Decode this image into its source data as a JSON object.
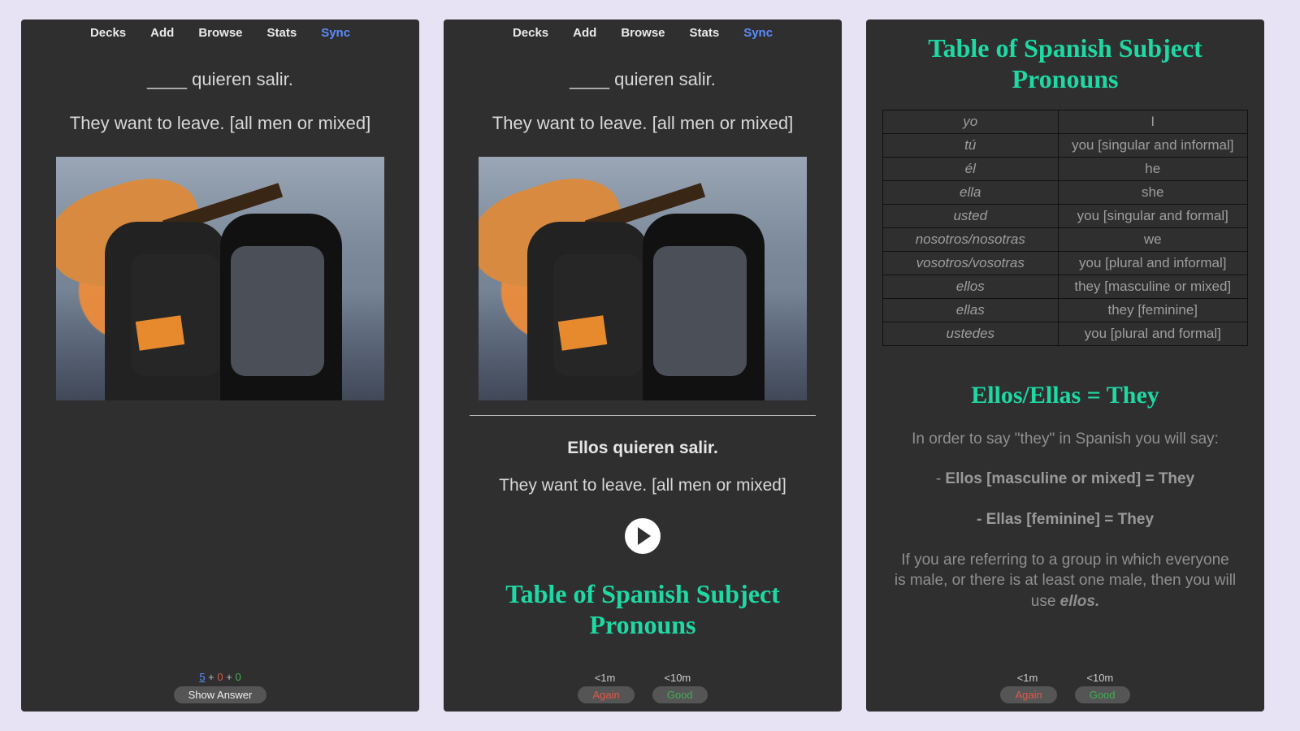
{
  "menubar": {
    "decks": "Decks",
    "add": "Add",
    "browse": "Browse",
    "stats": "Stats",
    "sync": "Sync"
  },
  "card": {
    "front_prompt": "____ quieren salir.",
    "front_translation": "They want to leave. [all men or mixed]",
    "answer_sentence": "Ellos quieren salir.",
    "answer_translation": "They want to leave. [all men or mixed]"
  },
  "footer1": {
    "new": "5",
    "learn": "0",
    "due": "0",
    "show_answer": "Show Answer"
  },
  "ease": {
    "again_time": "<1m",
    "good_time": "<10m",
    "again_label": "Again",
    "good_label": "Good"
  },
  "table": {
    "title": "Table of Spanish Subject Pronouns",
    "rows": [
      {
        "es": "yo",
        "en": "I"
      },
      {
        "es": "tú",
        "en": "you [singular and informal]"
      },
      {
        "es": "él",
        "en": "he"
      },
      {
        "es": "ella",
        "en": "she"
      },
      {
        "es": "usted",
        "en": "you [singular and formal]"
      },
      {
        "es": "nosotros/nosotras",
        "en": "we"
      },
      {
        "es": "vosotros/vosotras",
        "en": "you [plural and informal]"
      },
      {
        "es": "ellos",
        "en": "they [masculine or mixed]"
      },
      {
        "es": "ellas",
        "en": "they [feminine]"
      },
      {
        "es": "ustedes",
        "en": "you [plural and formal]"
      }
    ]
  },
  "explain": {
    "subhead": "Ellos/Ellas = They",
    "intro": "In order to say \"they\" in Spanish you will say:",
    "line1_dash": "- ",
    "line1_bold": "Ellos [masculine or mixed] = They",
    "line2": "- Ellas [feminine] = They",
    "para_pre": "If you are referring to a group in which everyone is male, or there is at least one male, then you will use ",
    "para_em": "ellos."
  }
}
